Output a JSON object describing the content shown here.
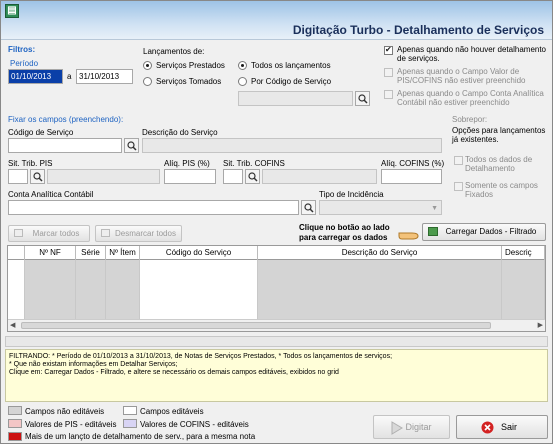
{
  "window": {
    "title": "Digitação Turbo - Detalhamento de Serviços"
  },
  "filtros": {
    "heading": "Filtros:",
    "periodo_label": "Período",
    "date_from": "01/10/2013",
    "date_sep": "a",
    "date_to": "31/10/2013"
  },
  "lancamentos": {
    "heading": "Lançamentos de:",
    "options": [
      "Serviços Prestados",
      "Serviços Tomados"
    ],
    "scope_options": [
      "Todos os lançamentos",
      "Por Código de Serviço"
    ]
  },
  "checks": {
    "c1": "Apenas quando não houver detalhamento de serviços.",
    "c2": "Apenas quando o Campo Valor de PIS/COFINS não estiver preenchido",
    "c3": "Apenas quando o Campo Conta Analítica Contábil não estiver preenchido"
  },
  "fixar": {
    "heading": "Fixar os campos (preenchendo):",
    "codigo_servico": "Código de Serviço",
    "descricao_servico": "Descrição do Serviço",
    "sit_trib_pis": "Sit. Trib. PIS",
    "aliq_pis": "Alíq. PIS (%)",
    "sit_trib_cofins": "Sit. Trib. COFINS",
    "aliq_cofins": "Alíq. COFINS (%)",
    "conta_analitica": "Conta Analítica Contábil",
    "tipo_incidencia": "Tipo de Incidência"
  },
  "sobrepor": {
    "heading": "Sobrepor:",
    "text": "Opções para lançamentos já existentes.",
    "opt1": "Todos os dados de Detalhamento",
    "opt2": "Somente os campos Fixados"
  },
  "actions": {
    "marcar": "Marcar todos",
    "desmarcar": "Desmarcar todos",
    "hint": "Clique no botão ao lado para carregar os dados",
    "carregar": "Carregar Dados - Filtrado"
  },
  "grid": {
    "columns": [
      "Nº NF",
      "Série",
      "Nº Ítem",
      "Código do Serviço",
      "Descrição do Serviço",
      "Descriç"
    ]
  },
  "info": {
    "line1": "FILTRANDO: * Período de 01/10/2013 a 31/10/2013, de Notas de Serviços Prestados, * Todos os lançamentos de serviços;",
    "line2": "* Que não existam informações em Detalhar Serviços;",
    "line3": "Clique em: Carregar Dados - Filtrado, e altere se necessário os demais campos editáveis, exibidos no grid"
  },
  "legend": {
    "nao_editaveis": "Campos não editáveis",
    "editaveis": "Campos editáveis",
    "pis": "Valores de PIS - editáveis",
    "cofins": "Valores de COFINS - editáveis",
    "mais": "Mais de um lançto de detalhamento de serv., para a mesma nota",
    "colors": {
      "nao_editaveis": "#d4d4d4",
      "editaveis": "#ffffff",
      "pis": "#f3c6c6",
      "cofins": "#d8d4f4",
      "mais": "#cc1111"
    }
  },
  "footer": {
    "digitar": "Digitar",
    "sair": "Sair"
  }
}
